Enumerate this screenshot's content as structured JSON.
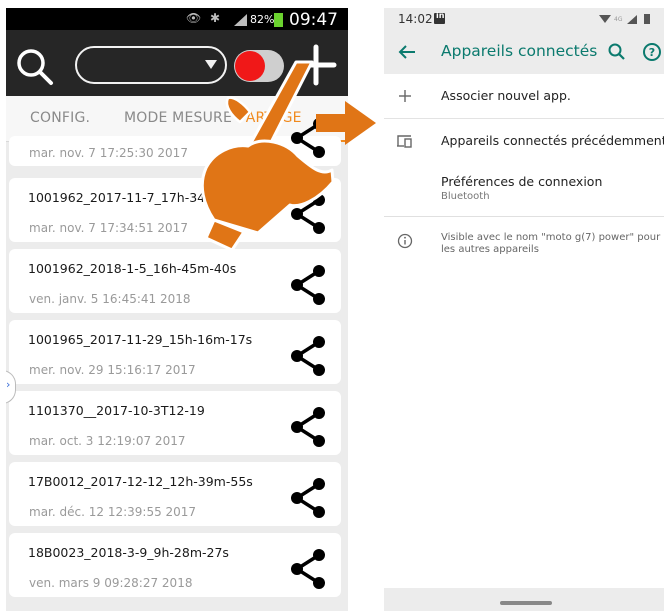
{
  "left_app": {
    "status_bar": {
      "battery_percent": "82%",
      "time": "09:47",
      "icons": [
        "eye-slash-icon",
        "bluetooth-icon",
        "signal-icon",
        "battery-icon"
      ]
    },
    "toolbar": {
      "search_icon": "search-icon",
      "add_icon": "plus-icon",
      "record_toggle_on": true
    },
    "tabs": [
      "CONFIG.",
      "MODE MESURE",
      "PARTAGE"
    ],
    "active_tab": "PARTAGE",
    "recordings": [
      {
        "title": "",
        "date": "mar. nov. 7 17:25:30 2017"
      },
      {
        "title": "1001962_2017-11-7_17h-34m",
        "date": "mar. nov. 7 17:34:51 2017"
      },
      {
        "title": "1001962_2018-1-5_16h-45m-40s",
        "date": "ven. janv. 5 16:45:41 2018"
      },
      {
        "title": "1001965_2017-11-29_15h-16m-17s",
        "date": "mer. nov. 29 15:16:17 2017"
      },
      {
        "title": "1101370__2017-10-3T12-19",
        "date": "mar. oct. 3 12:19:07 2017"
      },
      {
        "title": "17B0012_2017-12-12_12h-39m-55s",
        "date": "mar. déc. 12 12:39:55 2017"
      },
      {
        "title": "18B0023_2018-3-9_9h-28m-27s",
        "date": "ven. mars 9 09:28:27 2018"
      }
    ],
    "share_icon": "share-icon"
  },
  "right_app": {
    "status_bar": {
      "time": "14:02",
      "notification_icon": "linkedin-icon",
      "network": "4G"
    },
    "app_bar": {
      "title": "Appareils connectés",
      "back_icon": "arrow-back-icon",
      "search_icon": "search-icon",
      "help_icon": "help-icon"
    },
    "rows": {
      "associate": "Associer nouvel app.",
      "previous": "Appareils connectés précédemment",
      "prefs_title": "Préférences de connexion",
      "prefs_sub": "Bluetooth"
    },
    "info_text": "Visible avec le nom \"moto g(7) power\" pour les autres appareils"
  },
  "colors": {
    "accent_orange": "#f08a1e",
    "teal": "#0b7a6e",
    "record_red": "#f01818",
    "pointer_orange": "#e07516"
  }
}
